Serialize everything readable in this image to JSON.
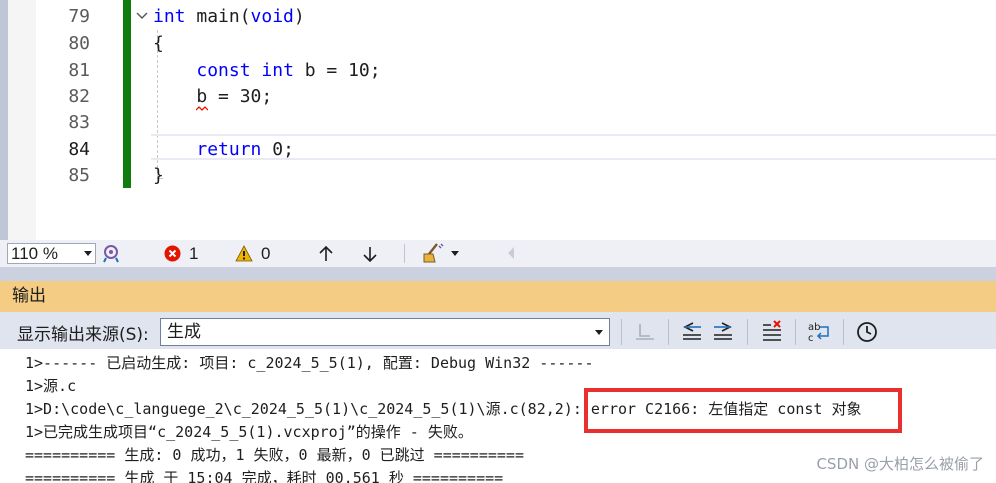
{
  "editor": {
    "lines": [
      {
        "num": "79",
        "code": [
          {
            "t": "int",
            "kw": true
          },
          {
            "t": " main(",
            "kw": false
          },
          {
            "t": "void",
            "kw": true
          },
          {
            "t": ")",
            "kw": false
          }
        ]
      },
      {
        "num": "80",
        "code": [
          {
            "t": "{",
            "kw": false
          }
        ]
      },
      {
        "num": "81",
        "code": [
          {
            "t": "    ",
            "kw": false
          },
          {
            "t": "const",
            "kw": true
          },
          {
            "t": " ",
            "kw": false
          },
          {
            "t": "int",
            "kw": true
          },
          {
            "t": " b = 10;",
            "kw": false
          }
        ]
      },
      {
        "num": "82",
        "code": [
          {
            "t": "    b = 30;",
            "kw": false
          }
        ]
      },
      {
        "num": "83",
        "code": []
      },
      {
        "num": "84",
        "code": [
          {
            "t": "    ",
            "kw": false
          },
          {
            "t": "return",
            "kw": true
          },
          {
            "t": " 0;",
            "kw": false
          }
        ]
      },
      {
        "num": "85",
        "code": [
          {
            "t": "}",
            "kw": false
          }
        ]
      }
    ],
    "current_line": "84"
  },
  "status": {
    "zoom": "110 %",
    "errors": "1",
    "warnings": "0"
  },
  "output": {
    "title": "输出",
    "source_label": "显示输出来源(S):",
    "source_value": "生成",
    "lines": [
      "1>------ 已启动生成: 项目: c_2024_5_5(1), 配置: Debug Win32 ------",
      "1>源.c",
      "1>D:\\code\\c_languege_2\\c_2024_5_5(1)\\c_2024_5_5(1)\\源.c(82,2): error C2166: 左值指定 const 对象",
      "1>已完成生成项目“c_2024_5_5(1).vcxproj”的操作 - 失败。",
      "========== 生成: 0 成功，1 失败，0 最新，0 已跳过 ==========",
      "========== 生成 于 15:04 完成，耗时 00.561 秒 =========="
    ]
  },
  "watermark": "CSDN @大柏怎么被偷了",
  "colors": {
    "keyword": "#0000ff",
    "change_bar": "#107c10",
    "output_title_bg": "#f5cc84",
    "error_red": "#e51400",
    "highlight_box": "#e8302f"
  }
}
